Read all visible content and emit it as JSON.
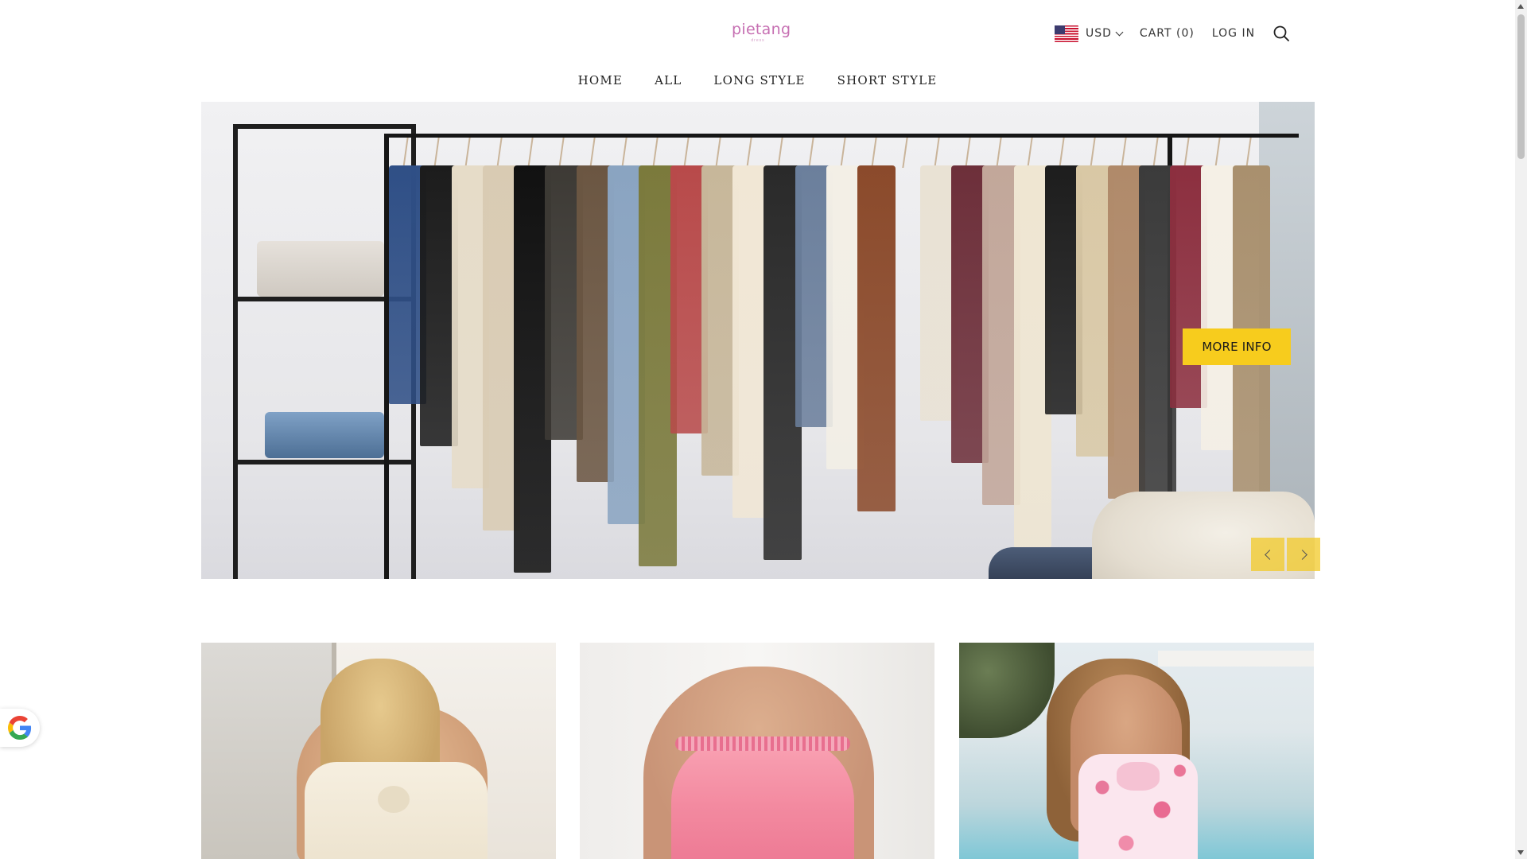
{
  "brand": {
    "name": "pietang",
    "tagline": "dress",
    "accent": "#c66fb2"
  },
  "header": {
    "currency": {
      "flag_icon": "us-flag-icon",
      "code": "USD",
      "dropdown_icon": "chevron-down-icon"
    },
    "cart_label": "CART (0)",
    "login_label": "LOG IN",
    "search_icon": "search-icon"
  },
  "nav": {
    "items": [
      {
        "label": "HOME"
      },
      {
        "label": "ALL"
      },
      {
        "label": "LONG STYLE"
      },
      {
        "label": "SHORT STYLE"
      }
    ]
  },
  "hero": {
    "button_label": "MORE INFO",
    "button_color": "#f7cc1d",
    "prev_icon": "chevron-left-icon",
    "next_icon": "chevron-right-icon"
  },
  "products": [
    {
      "image": "cream-strapless-twist-dress-image"
    },
    {
      "image": "pink-satin-slip-dress-image"
    },
    {
      "image": "pink-floral-strapless-dress-image"
    }
  ],
  "widgets": {
    "google_icon": "google-icon"
  }
}
